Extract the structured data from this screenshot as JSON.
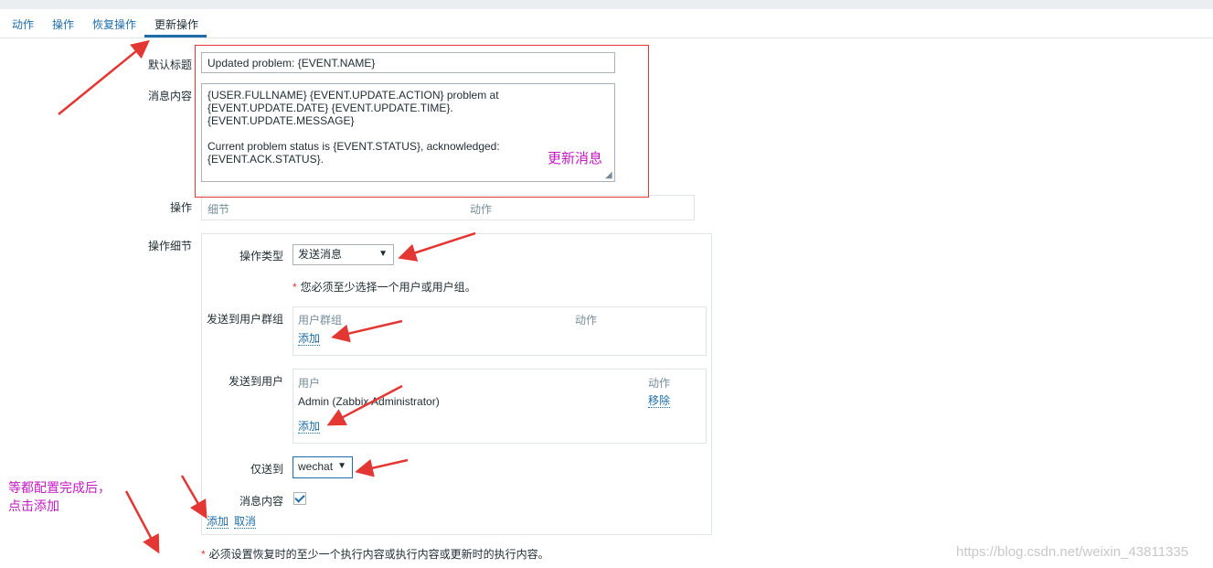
{
  "tabs": [
    {
      "label": "动作"
    },
    {
      "label": "操作"
    },
    {
      "label": "恢复操作"
    },
    {
      "label": "更新操作",
      "active": true
    }
  ],
  "form": {
    "default_subject_label": "默认标题",
    "default_subject_value": "Updated problem: {EVENT.NAME}",
    "default_message_label": "消息内容",
    "default_message_value": "{USER.FULLNAME} {EVENT.UPDATE.ACTION} problem at\n{EVENT.UPDATE.DATE} {EVENT.UPDATE.TIME}.\n{EVENT.UPDATE.MESSAGE}\n\nCurrent problem status is {EVENT.STATUS}, acknowledged:\n{EVENT.ACK.STATUS}.",
    "operations_label": "操作",
    "operations_columns": [
      "细节",
      "动作"
    ],
    "operation_details_label": "操作细节"
  },
  "details": {
    "operation_type_label": "操作类型",
    "operation_type_value": "发送消息",
    "requirement_note": "您必须至少选择一个用户或用户组。",
    "user_groups_label": "发送到用户群组",
    "user_groups_columns": [
      "用户群组",
      "动作"
    ],
    "user_groups_add": "添加",
    "users_label": "发送到用户",
    "users_columns": [
      "用户",
      "动作"
    ],
    "users_rows": [
      {
        "name": "Admin (Zabbix Administrator)",
        "action": "移除"
      }
    ],
    "users_add": "添加",
    "send_only_label": "仅送到",
    "send_only_value": "wechat",
    "message_label": "消息内容",
    "message_checked": true,
    "add_button": "添加",
    "cancel_button": "取消"
  },
  "footer_note": "必须设置恢复时的至少一个执行内容或执行内容或更新时的执行内容。",
  "annotations": {
    "update_message": "更新消息",
    "finish_note_line1": "等都配置完成后，",
    "finish_note_line2": "点击添加",
    "color": "#c21bc2",
    "arrow_color": "#e33734"
  },
  "watermark": "https://blog.csdn.net/weixin_43811335",
  "colors": {
    "link": "#1f6da8",
    "text": "#1f2c33",
    "muted": "#768d99",
    "required": "#e33734"
  }
}
